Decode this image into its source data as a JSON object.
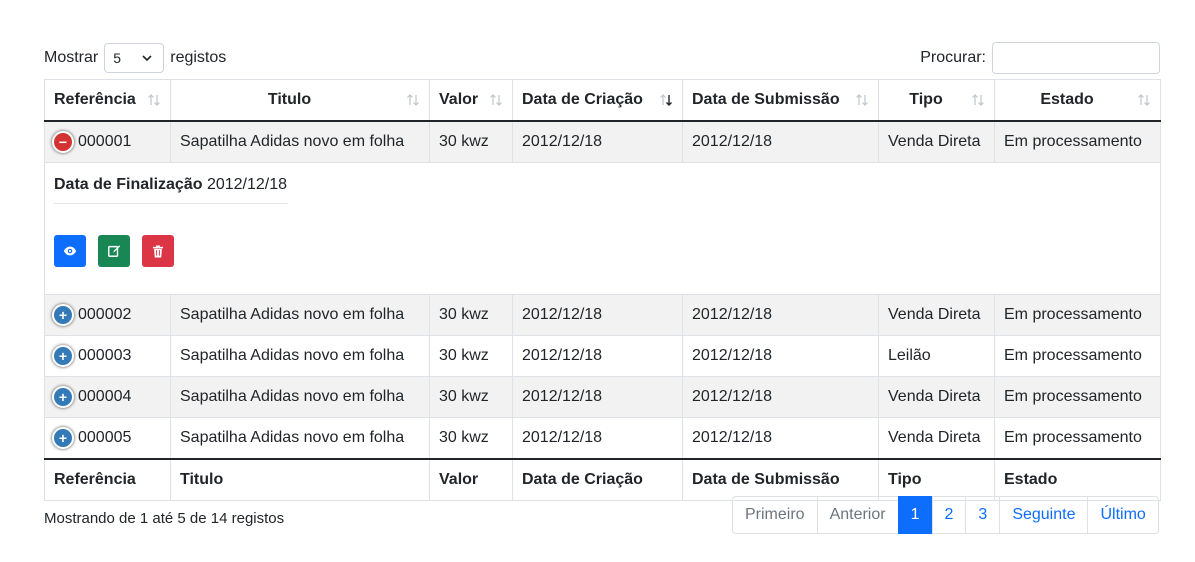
{
  "length": {
    "label_before": "Mostrar",
    "value": "5",
    "label_after": "registos"
  },
  "search": {
    "label": "Procurar:",
    "placeholder": ""
  },
  "table": {
    "headers": [
      "Referência",
      "Titulo",
      "Valor",
      "Data de Criação",
      "Data de Submissão",
      "Tipo",
      "Estado"
    ],
    "sorted_column": "Data de Criação",
    "rows": [
      {
        "ref": "000001",
        "titulo": "Sapatilha Adidas novo em folha",
        "valor": "30 kwz",
        "criacao": "2012/12/18",
        "submissao": "2012/12/18",
        "tipo": "Venda Direta",
        "estado": "Em processamento",
        "expanded": true
      },
      {
        "ref": "000002",
        "titulo": "Sapatilha Adidas novo em folha",
        "valor": "30 kwz",
        "criacao": "2012/12/18",
        "submissao": "2012/12/18",
        "tipo": "Venda Direta",
        "estado": "Em processamento",
        "expanded": false
      },
      {
        "ref": "000003",
        "titulo": "Sapatilha Adidas novo em folha",
        "valor": "30 kwz",
        "criacao": "2012/12/18",
        "submissao": "2012/12/18",
        "tipo": "Leilão",
        "estado": "Em processamento",
        "expanded": false
      },
      {
        "ref": "000004",
        "titulo": "Sapatilha Adidas novo em folha",
        "valor": "30 kwz",
        "criacao": "2012/12/18",
        "submissao": "2012/12/18",
        "tipo": "Venda Direta",
        "estado": "Em processamento",
        "expanded": false
      },
      {
        "ref": "000005",
        "titulo": "Sapatilha Adidas novo em folha",
        "valor": "30 kwz",
        "criacao": "2012/12/18",
        "submissao": "2012/12/18",
        "tipo": "Venda Direta",
        "estado": "Em processamento",
        "expanded": false
      }
    ],
    "detail": {
      "label": "Data de Finalização",
      "value": "2012/12/18"
    },
    "footers": [
      "Referência",
      "Titulo",
      "Valor",
      "Data de Criação",
      "Data de Submissão",
      "Tipo",
      "Estado"
    ]
  },
  "info": "Mostrando de 1 até 5 de 14 registos",
  "pagination": {
    "first": "Primeiro",
    "previous": "Anterior",
    "pages": [
      "1",
      "2",
      "3"
    ],
    "current": "1",
    "next": "Seguinte",
    "last": "Último"
  },
  "colors": {
    "primary": "#0d6efd",
    "success": "#198754",
    "danger": "#dc3545",
    "toggle_open": "#d33333",
    "toggle_closed": "#337ab7"
  }
}
